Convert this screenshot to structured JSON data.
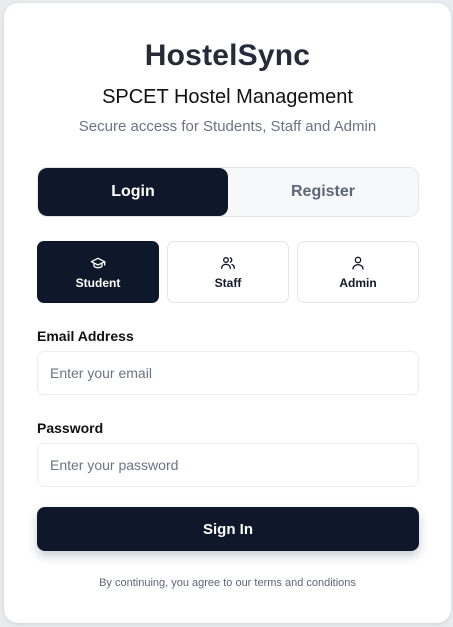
{
  "brand": {
    "name": "HostelSync",
    "subtitle": "SPCET Hostel Management",
    "tagline": "Secure access for Students, Staff and Admin"
  },
  "tabs": [
    {
      "label": "Login",
      "active": true
    },
    {
      "label": "Register",
      "active": false
    }
  ],
  "roles": [
    {
      "label": "Student",
      "icon": "graduation-cap-icon",
      "active": true
    },
    {
      "label": "Staff",
      "icon": "users-icon",
      "active": false
    },
    {
      "label": "Admin",
      "icon": "user-icon",
      "active": false
    }
  ],
  "form": {
    "email_label": "Email Address",
    "email_placeholder": "Enter your email",
    "email_value": "",
    "password_label": "Password",
    "password_placeholder": "Enter your password",
    "password_value": "",
    "submit_label": "Sign In"
  },
  "footer": {
    "terms": "By continuing, you agree to our terms and conditions"
  },
  "colors": {
    "primary": "#0f172a",
    "muted_text": "#6b7483",
    "border": "#e3e6eb"
  }
}
